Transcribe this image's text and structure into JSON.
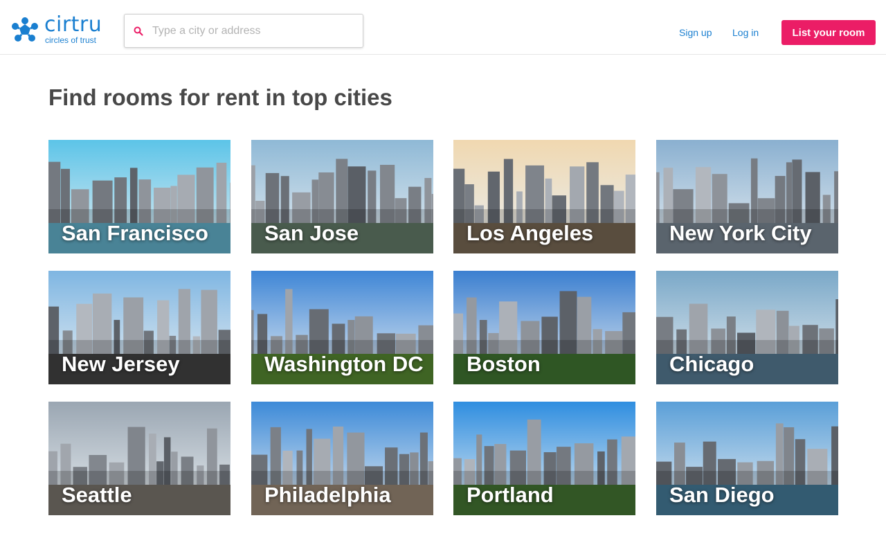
{
  "brand": {
    "name": "cirtru",
    "tagline": "circles of trust",
    "color": "#1a7fd0"
  },
  "search": {
    "placeholder": "Type a city or address",
    "value": "",
    "icon": "search-icon"
  },
  "nav": {
    "signup_label": "Sign up",
    "login_label": "Log in",
    "cta_label": "List your room",
    "cta_color": "#eb1d66"
  },
  "main": {
    "title": "Find rooms for rent in top cities",
    "cities": [
      {
        "name": "San Francisco",
        "slug": "san-francisco",
        "sky": "#5cc4e8",
        "ground": "#5aa0b8"
      },
      {
        "name": "San Jose",
        "slug": "san-jose",
        "sky": "#8fb9d6",
        "ground": "#5a6f5e"
      },
      {
        "name": "Los Angeles",
        "slug": "los-angeles",
        "sky": "#f0d8b0",
        "ground": "#6d5f4c"
      },
      {
        "name": "New York City",
        "slug": "new-york-city",
        "sky": "#8ab0d0",
        "ground": "#6e7a86"
      },
      {
        "name": "New Jersey",
        "slug": "new-jersey",
        "sky": "#7fb6e2",
        "ground": "#3c3c3c"
      },
      {
        "name": "Washington DC",
        "slug": "washington-dc",
        "sky": "#3f86d6",
        "ground": "#4d7a2c"
      },
      {
        "name": "Boston",
        "slug": "boston",
        "sky": "#3b7fd0",
        "ground": "#3a6a2c"
      },
      {
        "name": "Chicago",
        "slug": "chicago",
        "sky": "#7aa8c8",
        "ground": "#4d6e84"
      },
      {
        "name": "Seattle",
        "slug": "seattle",
        "sky": "#9aa6b2",
        "ground": "#6e6a62"
      },
      {
        "name": "Philadelphia",
        "slug": "philadelphia",
        "sky": "#3d8ad8",
        "ground": "#8a7a6a"
      },
      {
        "name": "Portland",
        "slug": "portland",
        "sky": "#2f8ee0",
        "ground": "#3e6a2e"
      },
      {
        "name": "San Diego",
        "slug": "san-diego",
        "sky": "#5a9fd8",
        "ground": "#3f6f8a"
      }
    ]
  }
}
